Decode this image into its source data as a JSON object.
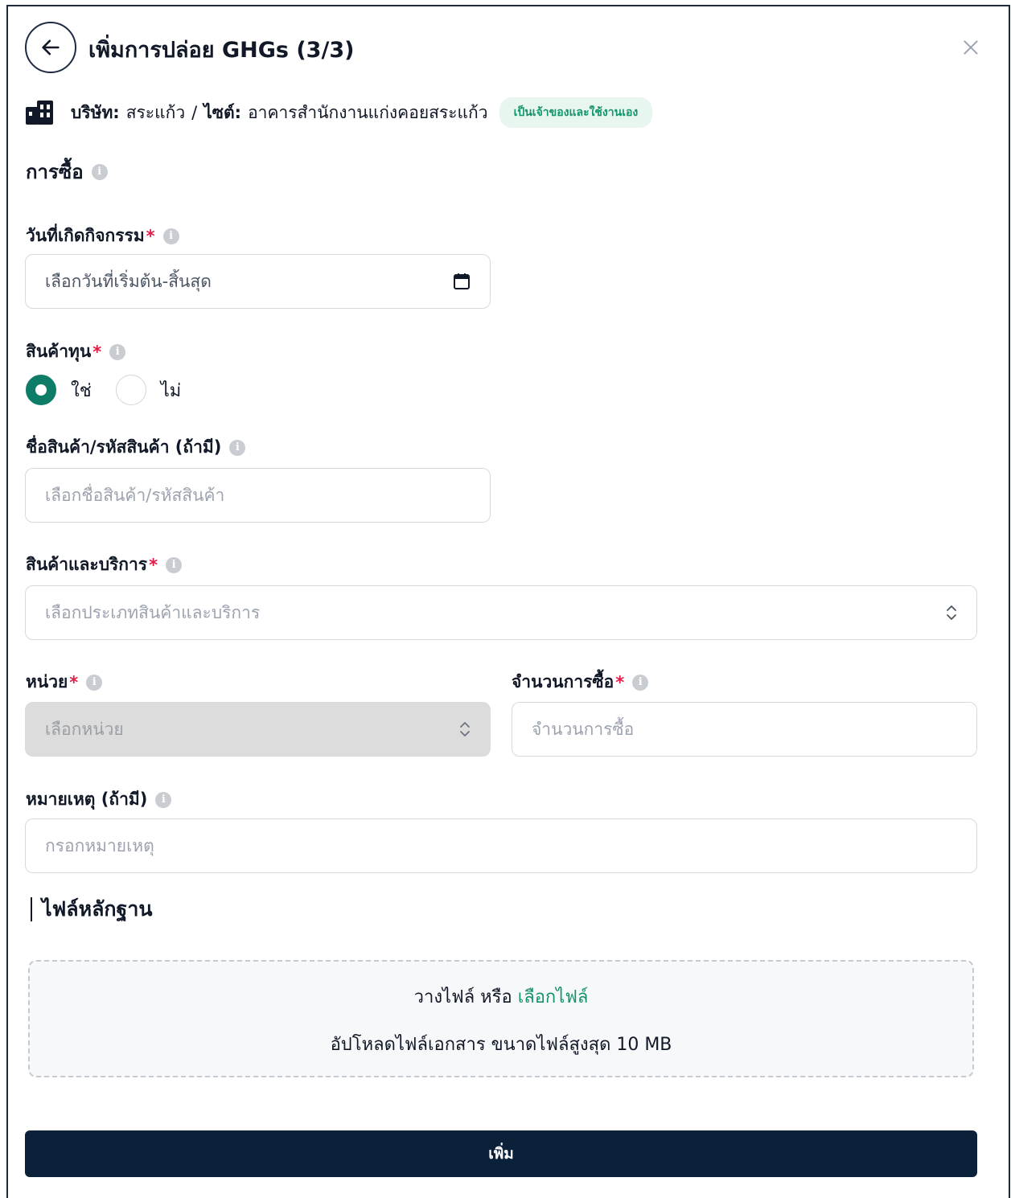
{
  "header": {
    "title": "เพิ่มการปล่อย GHGs (3/3)",
    "back_icon": "arrow-left-icon",
    "close_icon": "close-icon"
  },
  "info": {
    "company_label": "บริษัท:",
    "company_value": "สระแก้ว",
    "separator": "/",
    "site_label": "ไซต์:",
    "site_value": "อาคารสำนักงานแก่งคอยสระแก้ว",
    "badge": "เป็นเจ้าของและใช้งานเอง",
    "badge_color": "#14946a"
  },
  "section": {
    "title": "การซื้อ"
  },
  "activity_date": {
    "label": "วันที่เกิดกิจกรรม",
    "required": "*",
    "placeholder": "เลือกวันที่เริ่มต้น-สิ้นสุด"
  },
  "capital_goods": {
    "label": "สินค้าทุน",
    "required": "*",
    "options": [
      "ใช่",
      "ไม่"
    ],
    "selected": "ใช่"
  },
  "product_name": {
    "label": "ชื่อสินค้า/รหัสสินค้า (ถ้ามี)",
    "placeholder": "เลือกชื่อสินค้า/รหัสสินค้า"
  },
  "goods_services": {
    "label": "สินค้าและบริการ",
    "required": "*",
    "placeholder": "เลือกประเภทสินค้าและบริการ"
  },
  "unit": {
    "label": "หน่วย",
    "required": "*",
    "placeholder": "เลือกหน่วย"
  },
  "quantity": {
    "label": "จำนวนการซื้อ",
    "required": "*",
    "placeholder": "จำนวนการซื้อ"
  },
  "note": {
    "label": "หมายเหตุ (ถ้ามี)",
    "placeholder": "กรอกหมายเหตุ"
  },
  "evidence": {
    "title": "ไฟล์หลักฐาน",
    "drop_text": "วางไฟล์ หรือ",
    "browse_link": "เลือกไฟล์",
    "hint": "อัปโหลดไฟล์เอกสาร ขนาดไฟล์สูงสุด 10 MB"
  },
  "submit": {
    "label": "เพิ่ม"
  },
  "colors": {
    "accent": "#0e7d68",
    "primary_button": "#0b2039",
    "required": "#e11d48"
  }
}
